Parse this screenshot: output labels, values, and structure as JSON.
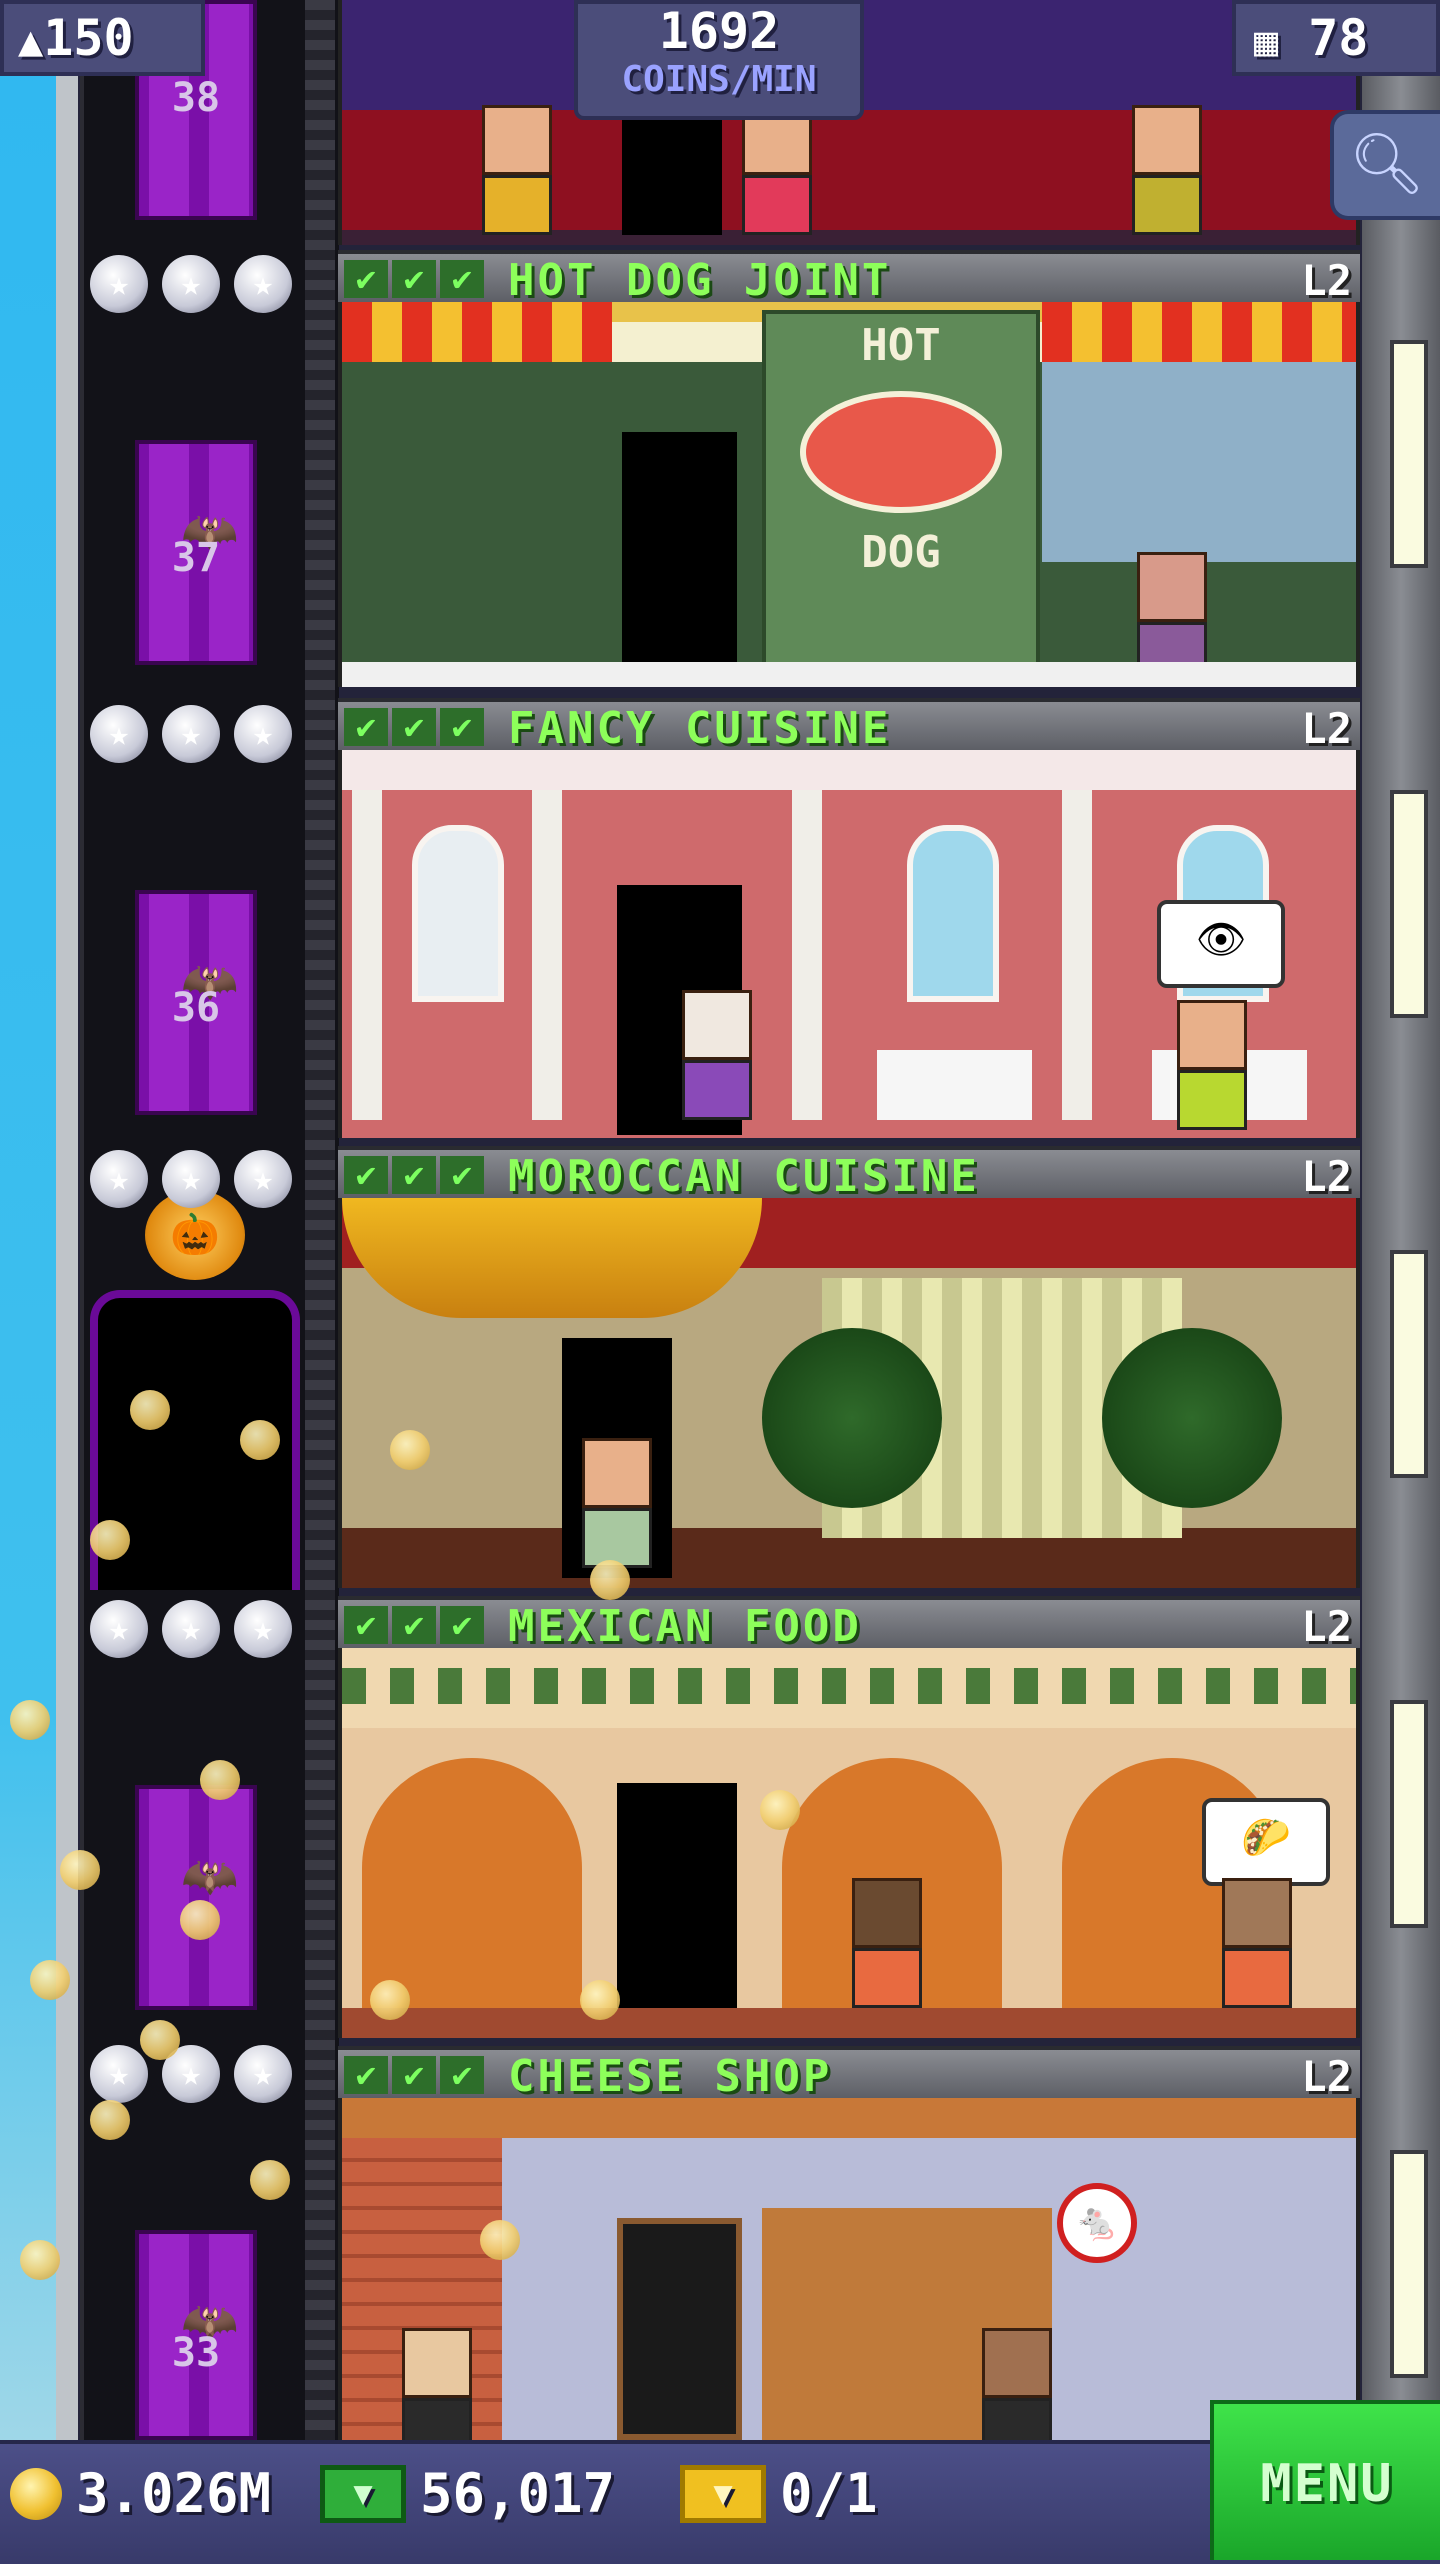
{
  "hud": {
    "population": "150",
    "coins_per_min_value": "1692",
    "coins_per_min_label": "COINS/MIN",
    "floors_count": "78"
  },
  "elevator": {
    "door_numbers": [
      "38",
      "37",
      "36",
      "33"
    ]
  },
  "floors": [
    {
      "name": "HOT DOG JOINT",
      "level": "L2",
      "sign_top": "HOT",
      "sign_bottom": "DOG"
    },
    {
      "name": "FANCY CUISINE",
      "level": "L2"
    },
    {
      "name": "MOROCCAN CUISINE",
      "level": "L2"
    },
    {
      "name": "MEXICAN FOOD",
      "level": "L2"
    },
    {
      "name": "CHEESE SHOP",
      "level": "L2"
    }
  ],
  "bottom_bar": {
    "coins": "3.026M",
    "bux": "56,017",
    "tickets": "0/1",
    "menu_label": "MENU"
  },
  "colors": {
    "header_text": "#8dff5a",
    "hud_pill": "#4b4d7a",
    "menu_button": "#2fcf3c",
    "elevator_door": "#9a24c8"
  },
  "icons": {
    "population": "person-up-icon",
    "floors": "building-icon",
    "search": "magnifier-icon",
    "coin": "coin-icon",
    "bux": "cash-icon",
    "ticket": "ticket-icon",
    "check": "check-icon",
    "star": "star-icon",
    "bat": "bat-icon",
    "pumpkin": "pumpkin-icon"
  }
}
